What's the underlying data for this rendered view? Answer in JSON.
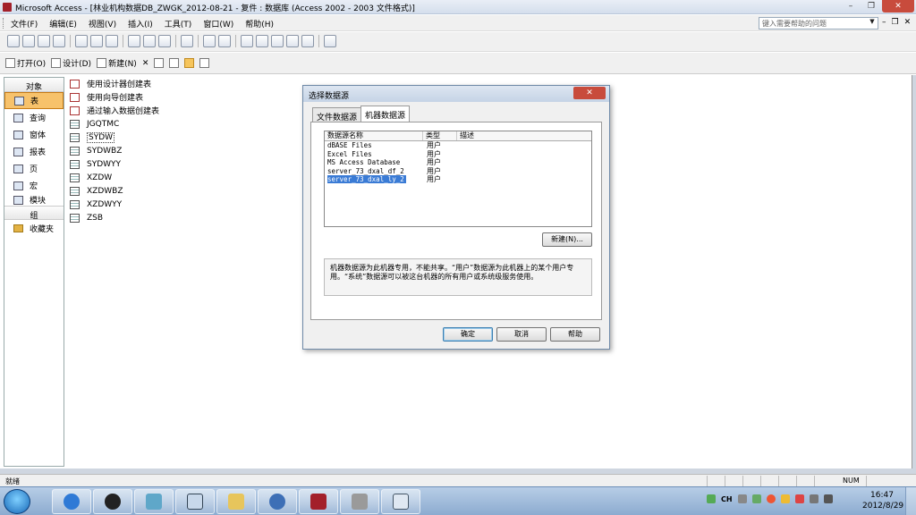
{
  "titlebar": {
    "title": "Microsoft Access - [林业机构数据DB_ZWGK_2012-08-21 - 复件 : 数据库 (Access 2002 - 2003 文件格式)]"
  },
  "menu": {
    "items": [
      "文件(F)",
      "编辑(E)",
      "视图(V)",
      "插入(I)",
      "工具(T)",
      "窗口(W)",
      "帮助(H)"
    ]
  },
  "help_search": {
    "placeholder": "键入需要帮助的问题"
  },
  "db_toolbar": {
    "open": "打开(O)",
    "design": "设计(D)",
    "new": "新建(N)"
  },
  "objects": {
    "header": "对象",
    "items": [
      "表",
      "查询",
      "窗体",
      "报表",
      "页",
      "宏",
      "模块"
    ],
    "group_header": "组",
    "favorites": "收藏夹"
  },
  "table_list": {
    "wizards": [
      "使用设计器创建表",
      "使用向导创建表",
      "通过输入数据创建表"
    ],
    "tables": [
      "JGQTMC",
      "SYDW",
      "SYDWBZ",
      "SYDWYY",
      "XZDW",
      "XZDWBZ",
      "XZDWYY",
      "ZSB"
    ]
  },
  "dialog": {
    "title": "选择数据源",
    "tabs": [
      "文件数据源",
      "机器数据源"
    ],
    "columns": [
      "数据源名称",
      "类型",
      "描述"
    ],
    "rows": [
      {
        "name": "dBASE Files",
        "type": "用户"
      },
      {
        "name": "Excel Files",
        "type": "用户"
      },
      {
        "name": "MS Access Database",
        "type": "用户"
      },
      {
        "name": "server_73_dxal_df_2",
        "type": "用户"
      },
      {
        "name": "server_73_dxal_ly_2",
        "type": "用户"
      }
    ],
    "new_button": "新建(N)...",
    "info": "机器数据源为此机器专用，不能共享。“用户”数据源为此机器上的某个用户专用。“系统”数据源可以被这台机器的所有用户或系统级服务使用。",
    "ok": "确定",
    "cancel": "取消",
    "help": "帮助"
  },
  "status": {
    "text": "就绪",
    "num": "NUM"
  },
  "taskbar": {
    "time": "16:47",
    "date": "2012/8/29",
    "lang": "CH"
  }
}
